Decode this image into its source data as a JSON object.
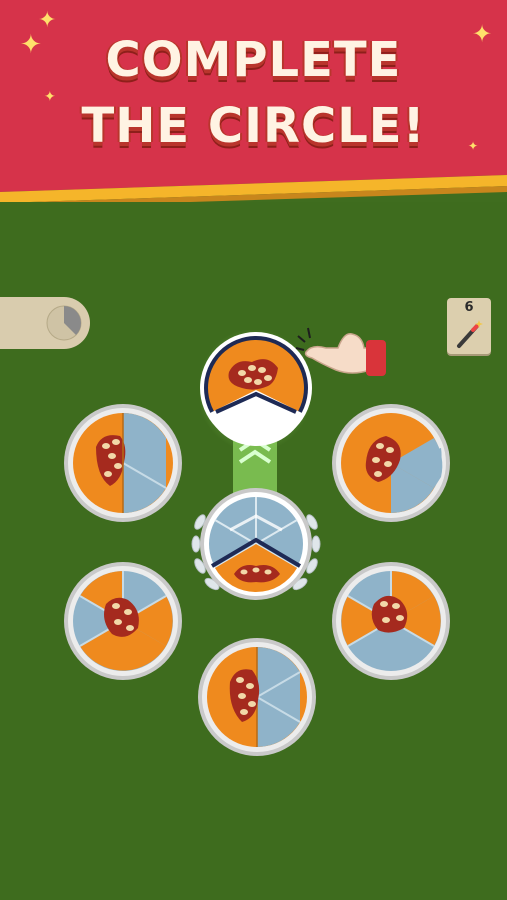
{
  "banner": {
    "line1": "COMPLETE",
    "line2": "THE CIRCLE!",
    "color": "#d6334a"
  },
  "hud": {
    "wand_count": "6",
    "icons": [
      "pie-progress-icon",
      "magic-wand-icon"
    ]
  },
  "colors": {
    "field": "#3e6c1e",
    "orange": "#ef8a1e",
    "blue": "#8fb3c9",
    "rim": "#bdbdbd",
    "sauce": "#a52a1e"
  },
  "pies": [
    {
      "id": "top",
      "filled": 4,
      "empty": 0,
      "selected": true
    },
    {
      "id": "upper-left",
      "filled": 4,
      "empty": 2
    },
    {
      "id": "upper-right",
      "filled": 4,
      "empty": 2
    },
    {
      "id": "center",
      "filled": 1,
      "empty": 5
    },
    {
      "id": "lower-left",
      "filled": 3,
      "empty": 3
    },
    {
      "id": "lower-right",
      "filled": 3,
      "empty": 3
    },
    {
      "id": "bottom",
      "filled": 3,
      "empty": 3
    }
  ]
}
